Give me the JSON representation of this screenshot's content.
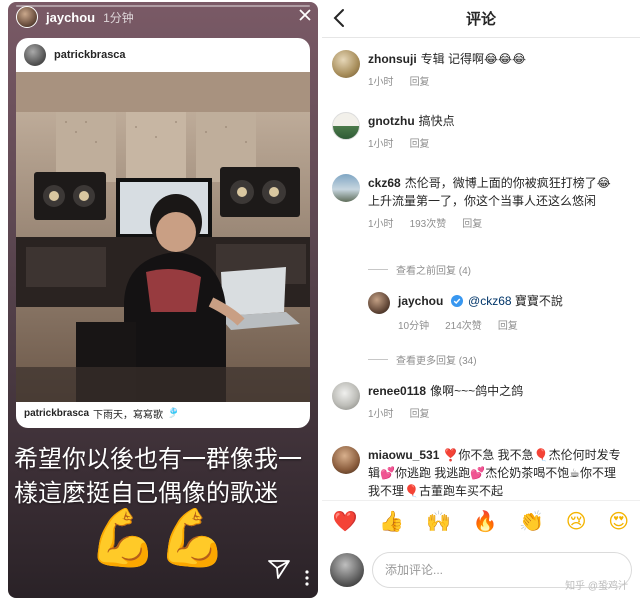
{
  "story": {
    "username": "jaychou",
    "time": "1分钟",
    "post": {
      "username": "patrickbrasca",
      "caption_user": "patrickbrasca",
      "caption_text": "下雨天，寫寫歌",
      "caption_emoji": "🎐"
    },
    "text": "希望你以後也有一群像我一樣這麼挺自己偶像的歌迷",
    "emoji": "💪💪"
  },
  "comments_panel": {
    "title": "评论",
    "comments": [
      {
        "user": "zhonsuji",
        "text": "专辑  记得啊😂😂😂",
        "time": "1小时",
        "reply": "回复"
      },
      {
        "user": "gnotzhu",
        "text": "搞快点",
        "time": "1小时",
        "reply": "回复"
      },
      {
        "user": "ckz68",
        "text": "杰伦哥，微博上面的你被疯狂打榜了😂上升流量第一了，你这个当事人还这么悠闲",
        "time": "1小时",
        "likes": "193次赞",
        "reply": "回复"
      },
      {
        "user": "renee0118",
        "text": "像啊~~~鸽中之鸽",
        "time": "1小时",
        "reply": "回复"
      },
      {
        "user": "miaowu_531",
        "text": "❣️你不急 我不急🎈杰伦何时发专辑💕你逃跑 我逃跑💕杰伦奶茶喝不饱☕你不理 我不理🎈古董跑车买不起",
        "time": "",
        "reply": ""
      }
    ],
    "view_previous": "查看之前回复 (4)",
    "view_more": "查看更多回复 (34)",
    "reply": {
      "user": "jaychou",
      "mention": "@ckz68",
      "text": "寶寶不說",
      "time": "10分钟",
      "likes": "214次赞",
      "reply": "回复"
    },
    "emoji_bar": [
      "❤️",
      "👍",
      "🙌",
      "🔥",
      "👏",
      "😢",
      "😍"
    ],
    "input_placeholder": "添加评论...",
    "watermark": "知乎 @蛩鸡汁"
  }
}
